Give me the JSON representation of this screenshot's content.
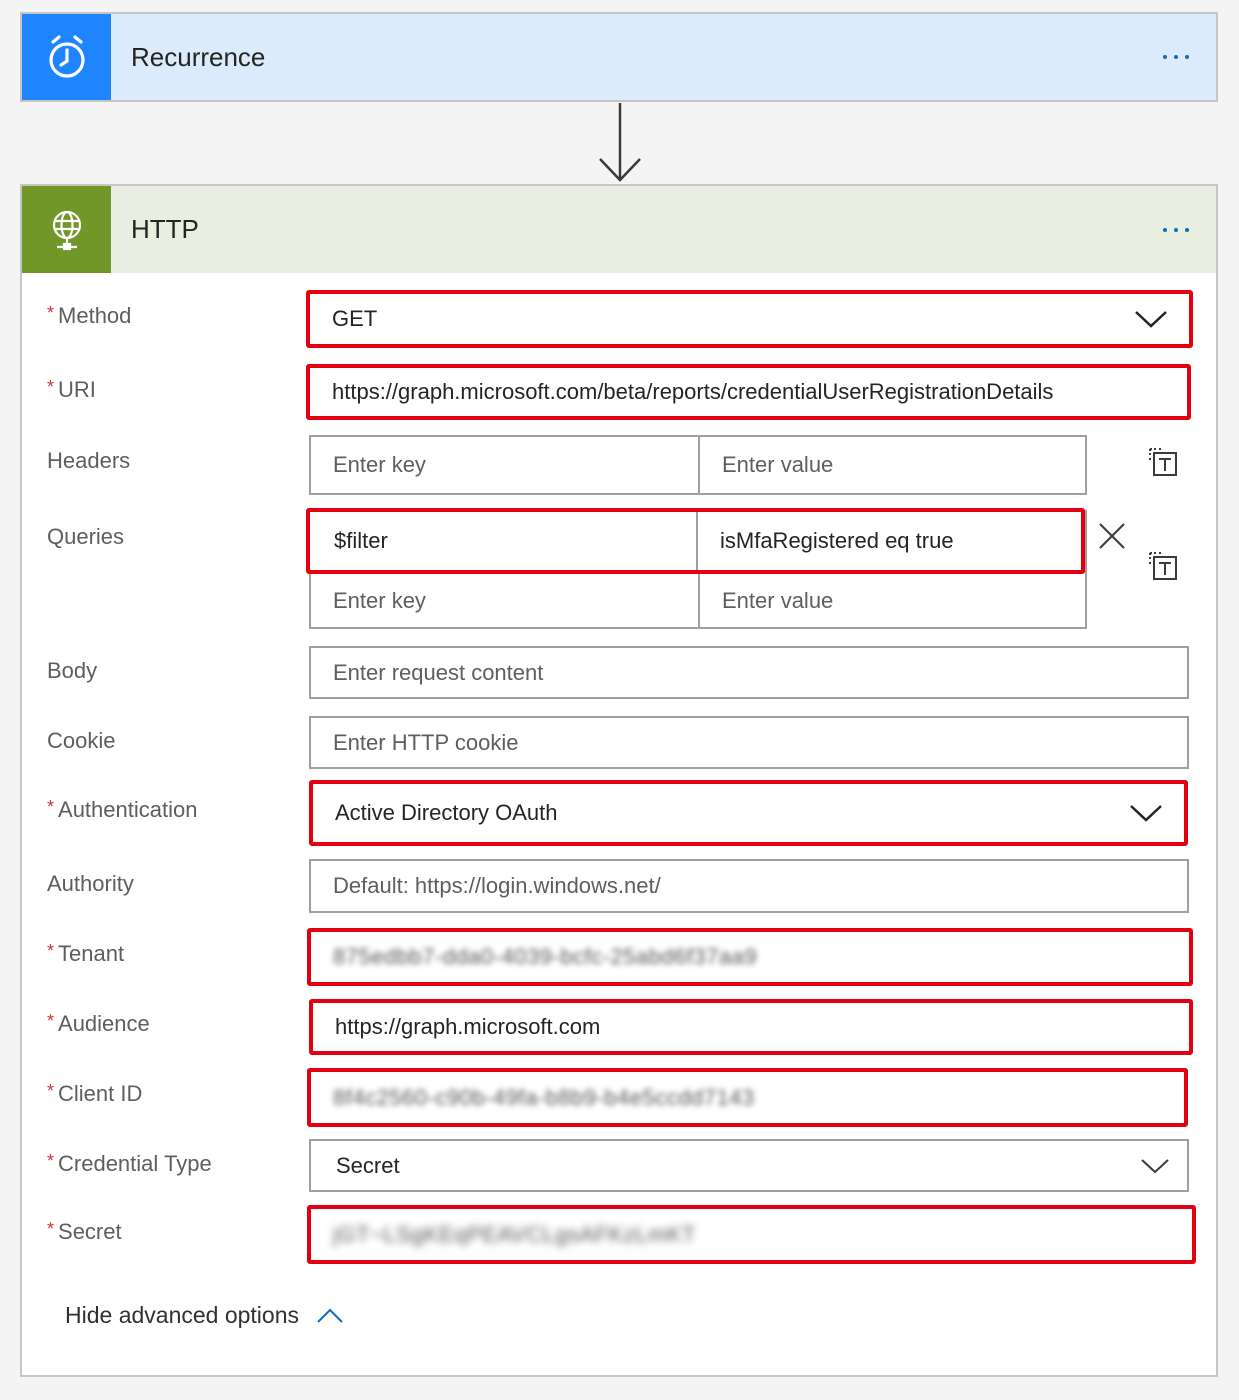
{
  "recurrence": {
    "title": "Recurrence",
    "icon": "alarm-clock-icon",
    "accent": "#1f85ff"
  },
  "http": {
    "title": "HTTP",
    "icon": "globe-icon",
    "accent": "#709727",
    "fields": {
      "method": {
        "label": "Method",
        "value": "GET"
      },
      "uri": {
        "label": "URI",
        "value": "https://graph.microsoft.com/beta/reports/credentialUserRegistrationDetails"
      },
      "headers": {
        "label": "Headers",
        "key_placeholder": "Enter key",
        "value_placeholder": "Enter value"
      },
      "queries": {
        "label": "Queries",
        "rows": [
          {
            "key": "$filter",
            "value": "isMfaRegistered eq true"
          }
        ],
        "key_placeholder": "Enter key",
        "value_placeholder": "Enter value"
      },
      "body": {
        "label": "Body",
        "placeholder": "Enter request content"
      },
      "cookie": {
        "label": "Cookie",
        "placeholder": "Enter HTTP cookie"
      },
      "authentication": {
        "label": "Authentication",
        "value": "Active Directory OAuth"
      },
      "authority": {
        "label": "Authority",
        "placeholder": "Default: https://login.windows.net/"
      },
      "tenant": {
        "label": "Tenant",
        "value": "875edbb7-dda0-4039-bcfc-25abd6f37aa9"
      },
      "audience": {
        "label": "Audience",
        "value": "https://graph.microsoft.com"
      },
      "client_id": {
        "label": "Client ID",
        "value": "8f4c2560-c90b-49fa-b8b9-b4e5ccdd7143"
      },
      "credential_type": {
        "label": "Credential Type",
        "value": "Secret"
      },
      "secret": {
        "label": "Secret",
        "value": "jGT~LSgKEqPEAVCLgsAFKzLmKT"
      }
    },
    "hide_advanced_label": "Hide advanced options"
  },
  "highlight_color": "#e3000f"
}
